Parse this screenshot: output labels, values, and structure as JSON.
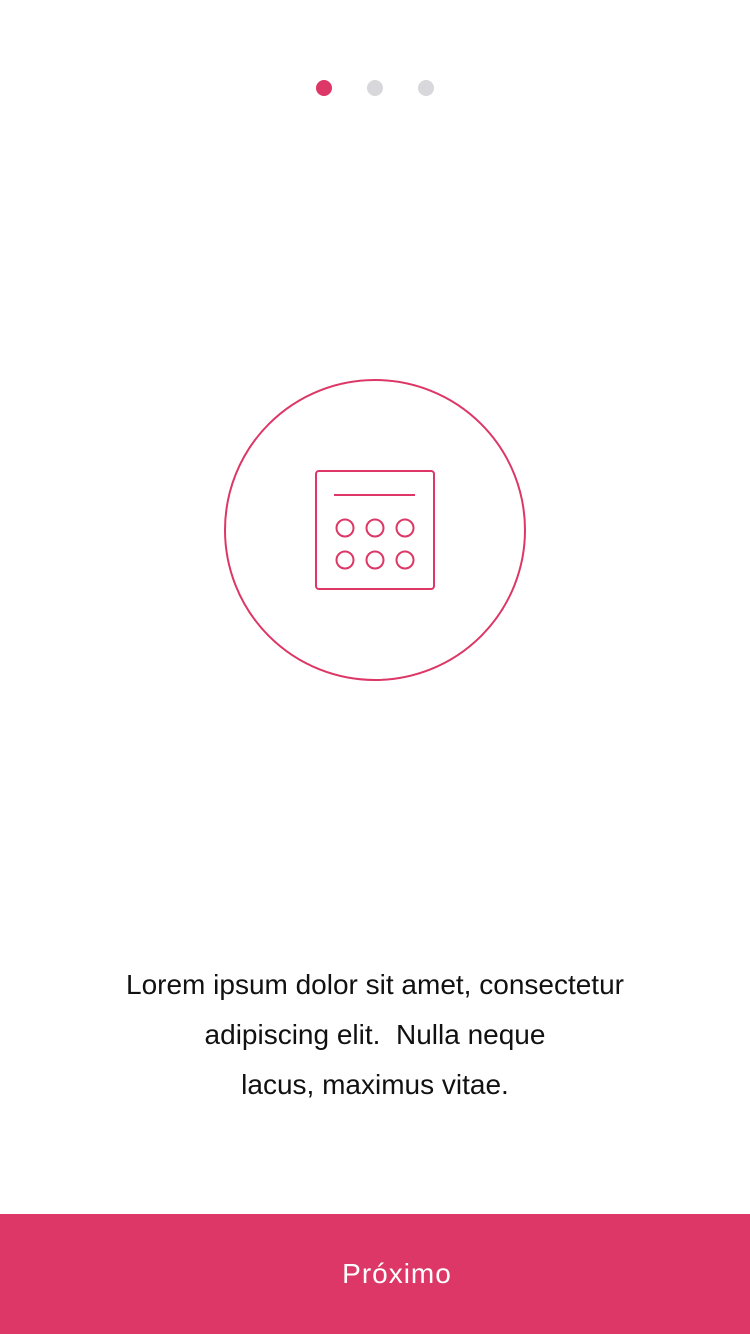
{
  "colors": {
    "accent": "#dc3766",
    "dot_inactive": "#d8d8dc",
    "text": "#111111",
    "background": "#ffffff"
  },
  "pager": {
    "total": 3,
    "active_index": 0
  },
  "hero": {
    "icon": "calendar-icon"
  },
  "description": {
    "lines": [
      "Lorem ipsum dolor sit amet, consectetur",
      "adipiscing elit.  Nulla neque",
      "lacus, maximus vitae."
    ]
  },
  "footer": {
    "next_label": "Próximo"
  }
}
